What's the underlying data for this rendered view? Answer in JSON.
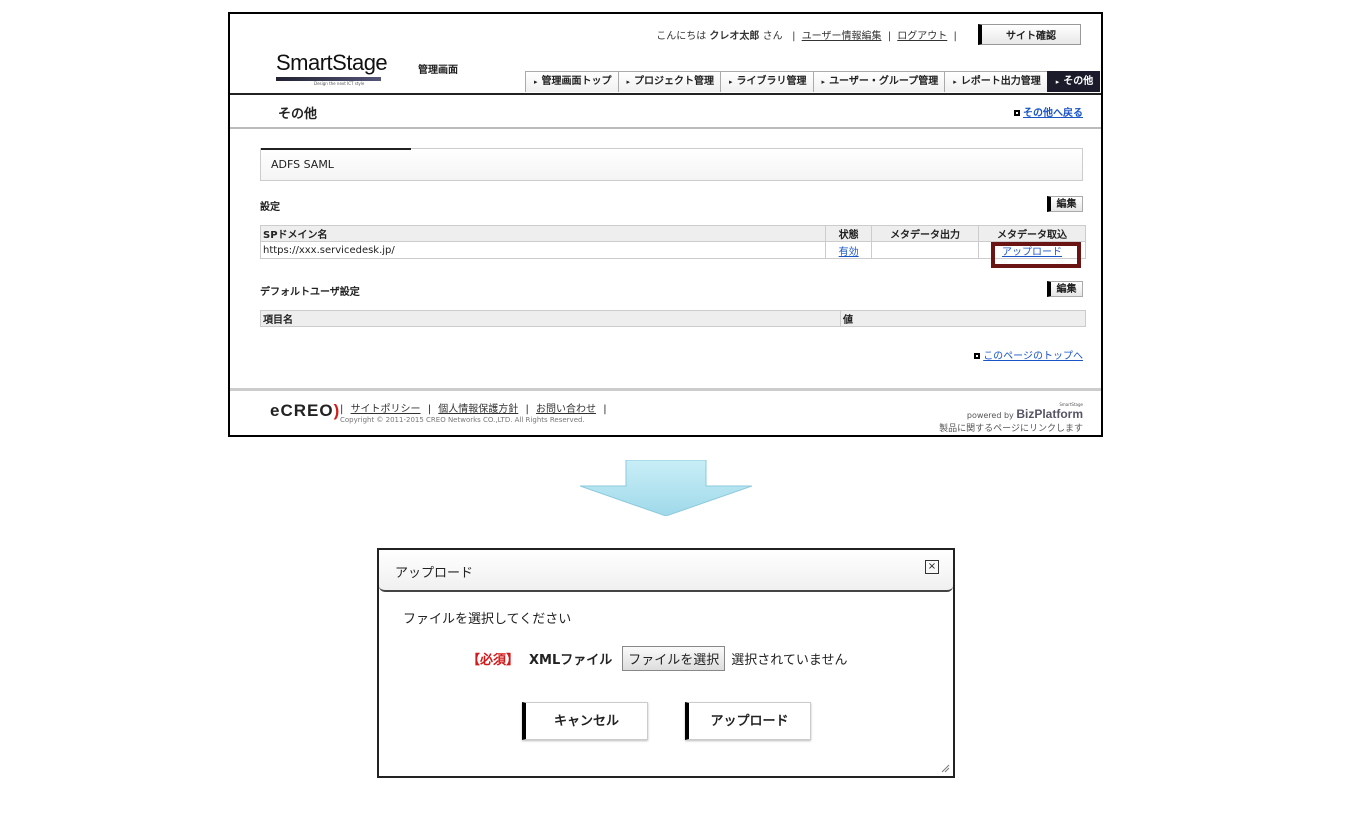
{
  "header": {
    "greeting": "こんにちは",
    "user_name": "クレオ太郎",
    "honorific": "さん",
    "sep": "|",
    "user_edit": "ユーザー情報編集",
    "logout": "ログアウト",
    "site_check": "サイト確認"
  },
  "logo": {
    "main": "SmartStage",
    "sub": "Design the next ICT style"
  },
  "mgr_label": "管理画面",
  "nav": [
    {
      "label": "管理画面トップ"
    },
    {
      "label": "プロジェクト管理"
    },
    {
      "label": "ライブラリ管理"
    },
    {
      "label": "ユーザー・グループ管理"
    },
    {
      "label": "レポート出力管理"
    },
    {
      "label": "その他",
      "active": true
    }
  ],
  "page": {
    "title": "その他",
    "back_link": "その他へ戻る"
  },
  "panel_title": "ADFS SAML",
  "settings": {
    "label": "設定",
    "edit": "編集",
    "columns": [
      "SPドメイン名",
      "状態",
      "メタデータ出力",
      "メタデータ取込"
    ],
    "row": {
      "domain": "https://xxx.servicedesk.jp/",
      "status": "有効",
      "meta_out": "",
      "meta_in": "アップロード"
    }
  },
  "default_user": {
    "label": "デフォルトユーザ設定",
    "edit": "編集",
    "columns": [
      "項目名",
      "値"
    ]
  },
  "page_top": "このページのトップへ",
  "footer": {
    "logo": "eCREO",
    "links": [
      "サイトポリシー",
      "個人情報保護方針",
      "お問い合わせ"
    ],
    "copyright": "Copyright © 2011-2015 CREO Networks CO.,LTD. All Rights Reserved.",
    "powered_by": "powered by",
    "biz": "BizPlatform",
    "biz_small": "SmartStage",
    "note": "製品に関するページにリンクします"
  },
  "dialog": {
    "title": "アップロード",
    "close": "×",
    "message": "ファイルを選択してください",
    "required": "【必須】",
    "field_label": "XMLファイル",
    "file_button": "ファイルを選択",
    "no_file": "選択されていません",
    "cancel": "キャンセル",
    "upload": "アップロード"
  },
  "colors": {
    "highlight": "#6b1414",
    "nav_active": "#1b1b2b",
    "required": "#d31919",
    "arrow": "#aee0ee"
  }
}
